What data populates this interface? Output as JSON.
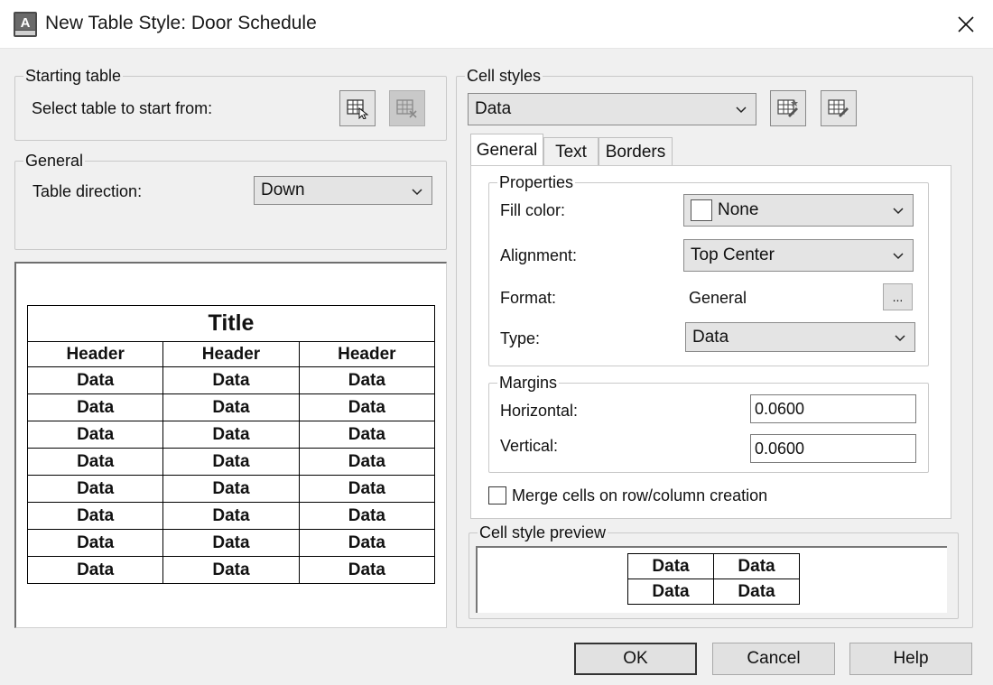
{
  "window": {
    "title": "New Table Style: Door Schedule",
    "close_label": "✕"
  },
  "starting_table": {
    "legend": "Starting table",
    "prompt": "Select table to start from:"
  },
  "general": {
    "legend": "General",
    "direction_label": "Table direction:",
    "direction_value": "Down"
  },
  "table_preview": {
    "title": "Title",
    "headers": [
      "Header",
      "Header",
      "Header"
    ],
    "rows": [
      [
        "Data",
        "Data",
        "Data"
      ],
      [
        "Data",
        "Data",
        "Data"
      ],
      [
        "Data",
        "Data",
        "Data"
      ],
      [
        "Data",
        "Data",
        "Data"
      ],
      [
        "Data",
        "Data",
        "Data"
      ],
      [
        "Data",
        "Data",
        "Data"
      ],
      [
        "Data",
        "Data",
        "Data"
      ],
      [
        "Data",
        "Data",
        "Data"
      ]
    ]
  },
  "cell_styles": {
    "legend": "Cell styles",
    "selected": "Data",
    "tabs": [
      "General",
      "Text",
      "Borders"
    ],
    "active_tab": "General",
    "properties": {
      "legend": "Properties",
      "fill_label": "Fill color:",
      "fill_value": "None",
      "alignment_label": "Alignment:",
      "alignment_value": "Top Center",
      "format_label": "Format:",
      "format_value": "General",
      "format_button": "...",
      "type_label": "Type:",
      "type_value": "Data"
    },
    "margins": {
      "legend": "Margins",
      "horizontal_label": "Horizontal:",
      "horizontal_value": "0.0600",
      "vertical_label": "Vertical:",
      "vertical_value": "0.0600"
    },
    "merge_label": "Merge cells on row/column creation",
    "merge_checked": false,
    "preview": {
      "legend": "Cell style preview",
      "rows": [
        [
          "Data",
          "Data"
        ],
        [
          "Data",
          "Data"
        ]
      ]
    }
  },
  "buttons": {
    "ok": "OK",
    "cancel": "Cancel",
    "help": "Help"
  },
  "icons": {
    "app": "autocad-app-icon",
    "select_table": "select-table-icon",
    "remove_table": "remove-table-icon",
    "create_style": "create-cell-style-icon",
    "manage_styles": "manage-cell-styles-icon"
  }
}
